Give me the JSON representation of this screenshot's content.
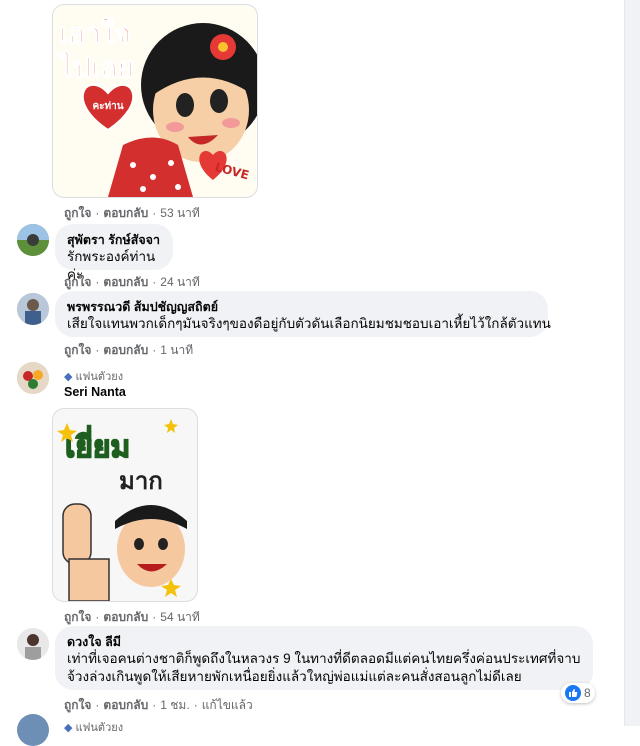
{
  "comment_actions": {
    "like": "ถูกใจ",
    "reply": "ตอบกลับ",
    "edited": "แก้ไขแล้ว"
  },
  "sticker1": {
    "line1": "เอาใจ",
    "line2": "ไปเลย",
    "heart": "คะท่าน",
    "love": "LOVE"
  },
  "sticker1_time": "53 นาที",
  "c1": {
    "name": "สุพัตรา รักษ์สัจจา",
    "text": "รักพระองค์ท่านค่ะ",
    "time": "24 นาที"
  },
  "c2": {
    "name": "พรพรรณวดี ส้มปชัญญสถิตย์",
    "text": "เสียใจแทนพวกเด็กๆมันจริงๆของดือยู่กับตัวดันเลือกนิยมชมชอบเอาเหี้ยไว้ใกล้ตัวแทน",
    "time": "1 นาที"
  },
  "c3": {
    "badge": "แฟนตัวยง",
    "name": "Seri Nanta",
    "time": "54 นาที"
  },
  "sticker2": {
    "line1": "เยี่ยม",
    "line2": "มาก"
  },
  "c4": {
    "name": "ดวงใจ ลีมี",
    "line1": "เท่าที่เจอคนต่างชาติก็พูดถึงในหลวงร 9 ในทางที่ดีตลอดมีแต่คนไทยครึ่งค่อนประเทศที่จาบ",
    "line2": "จ้วงล่วงเกินพูดให้เสียหายพักเหนื่อยยิ่งแล้วใหญ่พ่อแม่แต่ละคนสั่งสอนลูกไม่ดีเลย",
    "time": "1 ชม.",
    "reactions": "8"
  },
  "c5": {
    "badge": "แฟนตัวยง"
  }
}
